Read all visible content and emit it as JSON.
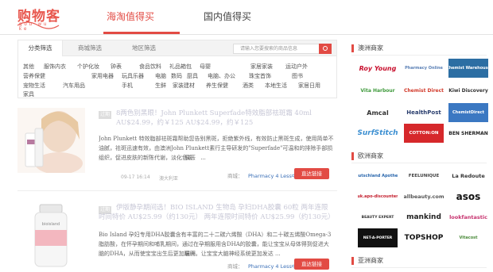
{
  "logo": {
    "main": "购物客",
    "sub": "gou wu ke"
  },
  "nav": {
    "tab1": "海淘值得买",
    "tab2": "国内值得买"
  },
  "filter": {
    "tabs": [
      "分类筛选",
      "商城筛选",
      "地区筛选"
    ],
    "search_placeholder": "请输入您要搜索的商品信息",
    "categories": [
      [
        "其他",
        "服饰内衣",
        "个护化妆",
        "钟表",
        "食品饮料",
        "礼品箱包",
        "母婴",
        "家居家装",
        "运动户外"
      ],
      [
        "营养保健",
        "家用电器",
        "玩具乐器",
        "电脑",
        "数码",
        "厨具",
        "电脑、办公",
        "珠宝首饰",
        "图书"
      ],
      [
        "宠物生活",
        "汽车用品",
        "手机",
        "生鲜",
        "家装建材",
        "养生保健",
        "酒类",
        "本地生活",
        "家居日用"
      ],
      [
        "家具"
      ]
    ]
  },
  "deals": [
    {
      "badge": "过期",
      "title": "8两色别黑眼！John Plunkett Superfade特效脂部祛斑霜 40ml",
      "price": "AU$24.99，约￥125 AU$24.99，约￥125",
      "desc": "John Plunkett 特效脂部祛斑霜帮助您告别黑斑，拒绝紫外线，有效防止黑斑生成，使用简单不油腻，祛斑迅速有效，由澳洲John Plunkett素行主导研发的\"Superfade\"可温和的排除手部损组织，促进皮肤的新陈代谢，淡化色斑、 ...",
      "more": "展开",
      "date": "09-17 16:14",
      "region": "澳大利亚",
      "merchant_label": "商城：",
      "merchant": "Pharmacy 4 Less中文官网",
      "btn": "直达链接"
    },
    {
      "badge": "过期",
      "title": "伊版静孕期间选！BIO ISLAND 生物岛 孕妇DHA胶囊 60粒 两年连限",
      "price": "时间特价 AU$25.99（约130元） 两年连限时间特价 AU$25.99（约130元）",
      "desc": "Bio Island 孕妇专用DHA胶囊含有丰富的二十二碳六烯酸（DHA）和二十碳五烯酸Omega-3脂肪酸，在怀孕期间和哺乳期间，通过在孕期服用含DHA的胶囊，能让宝宝从母体得到促进大脑的DHA，从而使宝宝出生后更加聪明。让宝宝大脑神经系统更加发达 ...",
      "more": "展开",
      "date": "",
      "region": "",
      "merchant_label": "商城：",
      "merchant": "Pharmacy 4 Less中文官网",
      "btn": "直达链接"
    }
  ],
  "sidebar": {
    "au_title": "澳洲商家",
    "eu_title": "欧洲商家",
    "asia_title": "亚洲商家",
    "au_merchants": [
      "Roy Young",
      "Pharmacy Online",
      "Chemist Warehouse",
      "Vita Harbour",
      "Chemist Direct",
      "Kiwi Discovery",
      "Amcal",
      "HealthPost",
      "ChemistDirect",
      "SurfStitch",
      "COTTON:ON",
      "BEN SHERMAN"
    ],
    "eu_merchants": [
      "Deutschland Apotheke",
      "FEELUNIQUE",
      "La Redoute",
      "uk.apo-discounter",
      "allbeauty.com",
      "asos",
      "BEAUTY EXPERT",
      "mankind",
      "lookfantastic",
      "NET-A-PORTER",
      "TOPSHOP",
      "Vitacost"
    ]
  },
  "colors": {
    "accent": "#e24b44",
    "link": "#3a6fb7"
  }
}
